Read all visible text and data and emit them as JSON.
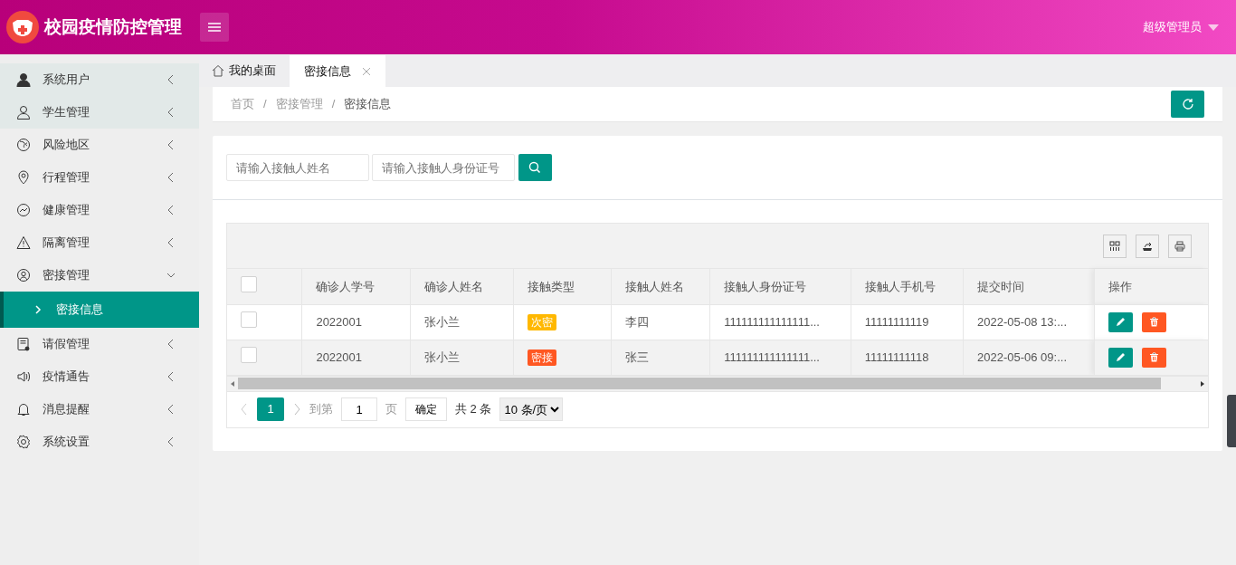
{
  "app": {
    "title": "校园疫情防控管理",
    "user": "超级管理员"
  },
  "sidebar": {
    "items": [
      {
        "label": "系统用户",
        "highlighted": true,
        "expanded": false
      },
      {
        "label": "学生管理",
        "highlighted": true,
        "expanded": false
      },
      {
        "label": "风险地区",
        "highlighted": false,
        "expanded": false
      },
      {
        "label": "行程管理",
        "highlighted": false,
        "expanded": false
      },
      {
        "label": "健康管理",
        "highlighted": false,
        "expanded": false
      },
      {
        "label": "隔离管理",
        "highlighted": false,
        "expanded": false
      },
      {
        "label": "密接管理",
        "highlighted": false,
        "expanded": true,
        "children": [
          {
            "label": "密接信息",
            "selected": true
          }
        ]
      },
      {
        "label": "请假管理",
        "highlighted": false,
        "expanded": false
      },
      {
        "label": "疫情通告",
        "highlighted": false,
        "expanded": false
      },
      {
        "label": "消息提醒",
        "highlighted": false,
        "expanded": false
      },
      {
        "label": "系统设置",
        "highlighted": false,
        "expanded": false
      }
    ]
  },
  "tabs": [
    {
      "label": "我的桌面",
      "kind": "home",
      "selected": false,
      "closable": false
    },
    {
      "label": "密接信息",
      "kind": "page",
      "selected": true,
      "closable": true
    }
  ],
  "breadcrumb": {
    "separator": "/",
    "items": [
      "首页",
      "密接管理",
      "密接信息"
    ]
  },
  "search": {
    "fields": [
      {
        "placeholder": "请输入接触人姓名"
      },
      {
        "placeholder": "请输入接触人身份证号"
      }
    ]
  },
  "table": {
    "all_checked": false,
    "columns": [
      "确诊人学号",
      "确诊人姓名",
      "接触类型",
      "接触人姓名",
      "接触人身份证号",
      "接触人手机号",
      "提交时间",
      "操作"
    ],
    "rows": [
      {
        "checked": false,
        "student_id": "2022001",
        "confirmed_name": "张小兰",
        "contact_type": {
          "label": "次密",
          "color": "#ffb800"
        },
        "contact_name": "李四",
        "id_number": "111111111111111...",
        "phone": "11111111119",
        "submitted": "2022-05-08 13:..."
      },
      {
        "checked": false,
        "student_id": "2022001",
        "confirmed_name": "张小兰",
        "contact_type": {
          "label": "密接",
          "color": "#ff5722"
        },
        "contact_name": "张三",
        "id_number": "111111111111111...",
        "phone": "11111111118",
        "submitted": "2022-05-06 09:..."
      }
    ]
  },
  "pagination": {
    "pages": [
      {
        "label": "1",
        "selected": true
      }
    ],
    "goto_label": "到第",
    "goto_value": "1",
    "page_unit": "页",
    "confirm": "确定",
    "total": "共 2 条",
    "page_size": "10 条/页"
  }
}
